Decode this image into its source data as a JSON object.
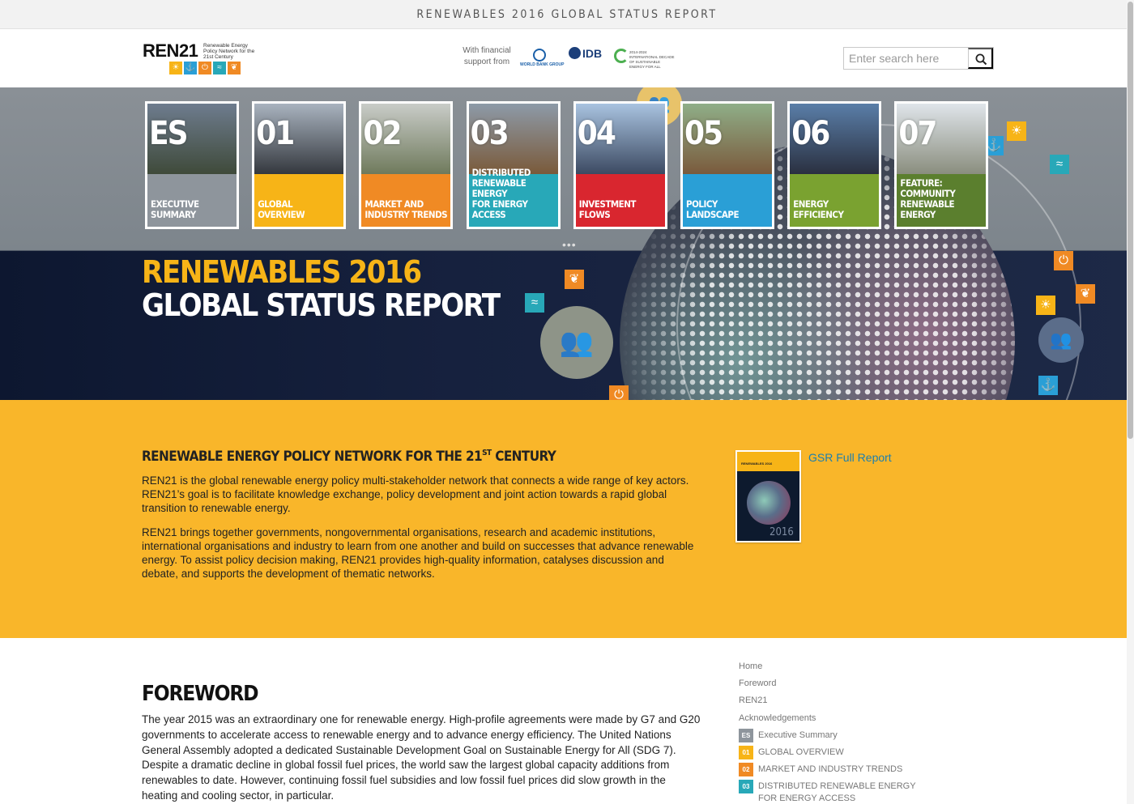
{
  "topbar": {
    "title": "RENEWABLES 2016 GLOBAL STATUS REPORT"
  },
  "header": {
    "logo": {
      "name": "REN21",
      "tagline": "Renewable Energy Policy Network for the 21st Century",
      "icon_colors": [
        "#f7b417",
        "#2a9fd6",
        "#f08a24",
        "#28a8b8",
        "#f08a24"
      ]
    },
    "support_text": "With financial support from",
    "sponsors": {
      "world_bank": "WORLD BANK GROUP",
      "idb": "IDB",
      "se4all": "2014-2024 INTERNATIONAL DECADE OF SUSTAINABLE ENERGY FOR ALL"
    },
    "search": {
      "placeholder": "Enter search here",
      "icon": "search-icon"
    }
  },
  "hero": {
    "tiles": [
      {
        "num": "ES",
        "caption": "EXECUTIVE SUMMARY",
        "color": "#8e959c",
        "photo": [
          "#6e7c8e",
          "#3f4a3a"
        ]
      },
      {
        "num": "01",
        "caption": "GLOBAL OVERVIEW",
        "color": "#f7b417",
        "photo": [
          "#a9b3bf",
          "#34383e"
        ]
      },
      {
        "num": "02",
        "caption": "MARKET AND\nINDUSTRY TRENDS",
        "color": "#f08a24",
        "photo": [
          "#c9ccc8",
          "#6f7a5c"
        ]
      },
      {
        "num": "03",
        "caption": "DISTRIBUTED\nRENEWABLE ENERGY\nFOR ENERGY ACCESS",
        "color": "#28a8b8",
        "photo": [
          "#8d9aa8",
          "#7a5a3a"
        ]
      },
      {
        "num": "04",
        "caption": "INVESTMENT FLOWS",
        "color": "#d9262f",
        "photo": [
          "#a9c3e0",
          "#3c4a62"
        ]
      },
      {
        "num": "05",
        "caption": "POLICY LANDSCAPE",
        "color": "#2a9fd6",
        "photo": [
          "#8fae88",
          "#7a5a3c"
        ]
      },
      {
        "num": "06",
        "caption": "ENERGY EFFICIENCY",
        "color": "#7aa230",
        "photo": [
          "#5a7ea8",
          "#2a3040"
        ]
      },
      {
        "num": "07",
        "caption": "FEATURE:\nCOMMUNITY\nRENEWABLE ENERGY",
        "color": "#5b7f2e",
        "photo": [
          "#dfe5ea",
          "#8a8e7e"
        ]
      }
    ],
    "title_line1": "RENEWABLES 2016",
    "title_line2": "GLOBAL STATUS REPORT",
    "indicator": "•••"
  },
  "intro": {
    "heading_main": "RENEWABLE ENERGY POLICY NETWORK FOR THE 21",
    "heading_sup": "ST",
    "heading_end": " CENTURY",
    "para1": "REN21 is the global renewable energy policy multi-stakeholder network that connects a wide range of key actors. REN21’s goal is to facilitate knowledge exchange, policy development and joint action towards a rapid global transition to renewable energy.",
    "para2": "REN21 brings together governments, nongovernmental organisations, research and academic institutions, international organisations and industry to learn from one another and build on successes that advance renewable energy. To assist policy decision making, REN21 provides high-quality information, catalyses discussion and debate, and supports the development of thematic networks.",
    "report_link": "GSR Full Report",
    "cover": {
      "title": "RENEWABLES 2016",
      "year": "2016"
    }
  },
  "foreword": {
    "heading": "FOREWORD",
    "text": "The year 2015 was an extraordinary one for renewable energy. High-profile agreements were made by G7 and G20 governments to accelerate access to renewable energy and to advance energy efficiency. The United Nations General Assembly adopted a dedicated Sustainable Development Goal on Sustainable Energy for All (SDG 7). Despite a dramatic decline in global fossil fuel prices, the world saw the largest global capacity additions from renewables to date. However, continuing fossil fuel subsidies and low fossil fuel prices did slow growth in the heating and cooling sector, in particular."
  },
  "sidenav": {
    "items": [
      {
        "label": "Home"
      },
      {
        "label": "Foreword"
      },
      {
        "label": "REN21"
      },
      {
        "label": "Acknowledgements"
      }
    ],
    "chapters": [
      {
        "code": "ES",
        "label": "Executive Summary",
        "color": "#8e959c"
      },
      {
        "code": "01",
        "label": "GLOBAL OVERVIEW",
        "color": "#f7b417"
      },
      {
        "code": "02",
        "label": "MARKET AND INDUSTRY TRENDS",
        "color": "#f08a24"
      },
      {
        "code": "03",
        "label": "DISTRIBUTED RENEWABLE ENERGY FOR ENERGY ACCESS",
        "color": "#28a8b8"
      }
    ]
  }
}
